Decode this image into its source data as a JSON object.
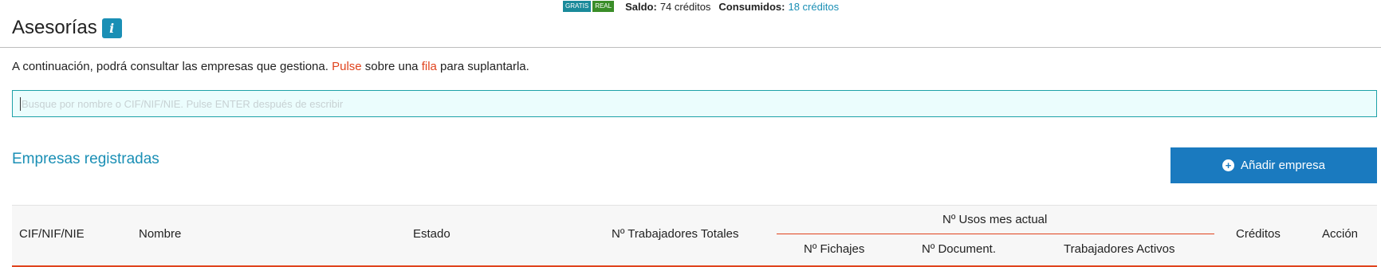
{
  "topbar": {
    "badge_free": "GRATIS",
    "badge_real": "REAL",
    "saldo_label": "Saldo:",
    "saldo_value": "74 créditos",
    "consumidos_label": "Consumidos:",
    "consumidos_value": "18 créditos"
  },
  "header": {
    "title": "Asesorías",
    "info_icon": "i"
  },
  "intro": {
    "part1": "A continuación, podrá consultar las empresas que gestiona.",
    "pulse": "Pulse",
    "part2": "sobre una",
    "fila": "fila",
    "part3": "para suplantarla."
  },
  "search": {
    "placeholder": "Busque por nombre o CIF/NIF/NIE. Pulse ENTER después de escribir",
    "value": ""
  },
  "section": {
    "title": "Empresas registradas",
    "add_button": "Añadir empresa"
  },
  "table": {
    "headers": {
      "cif": "CIF/NIF/NIE",
      "nombre": "Nombre",
      "estado": "Estado",
      "trabajadores_totales": "Nº Trabajadores Totales",
      "usos_group": "Nº Usos mes actual",
      "fichajes": "Nº Fichajes",
      "document": "Nº Document.",
      "trabajadores_activos": "Trabajadores Activos",
      "creditos": "Créditos",
      "accion": "Acción"
    }
  },
  "colors": {
    "accent_blue": "#1a8fb5",
    "button_blue": "#1a7abf",
    "highlight_red": "#e0431d",
    "search_border": "#1ea2a8"
  },
  "icons": {
    "info": "info-icon",
    "add": "plus-circle-icon"
  }
}
